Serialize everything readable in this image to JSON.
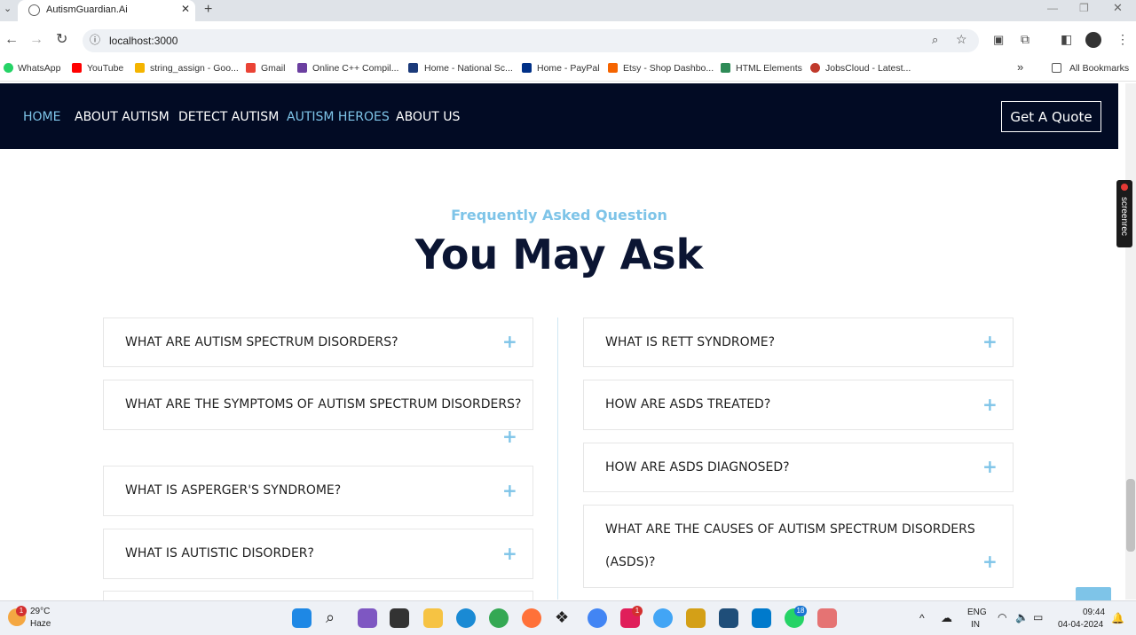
{
  "browser": {
    "tab_title": "AutismGuardian.Ai",
    "url": "localhost:3000",
    "bookmarks": [
      "WhatsApp",
      "YouTube",
      "string_assign - Goo...",
      "Gmail",
      "Online C++ Compil...",
      "Home - National Sc...",
      "Home - PayPal",
      "Etsy - Shop Dashbo...",
      "HTML Elements",
      "JobsCloud - Latest..."
    ],
    "all_bookmarks": "All Bookmarks",
    "overflow": "»"
  },
  "nav": {
    "links": [
      "HOME",
      "ABOUT AUTISM",
      "DETECT AUTISM",
      "AUTISM HEROES",
      "ABOUT US"
    ],
    "quote": "Get A Quote"
  },
  "screenrec": "screenrec",
  "faq": {
    "subtitle": "Frequently Asked Question",
    "title": "You May Ask",
    "left": [
      "WHAT ARE AUTISM SPECTRUM DISORDERS?",
      "WHAT ARE THE SYMPTOMS OF AUTISM SPECTRUM DISORDERS?",
      "WHAT IS ASPERGER'S SYNDROME?",
      "WHAT IS AUTISTIC DISORDER?"
    ],
    "right": [
      "WHAT IS RETT SYNDROME?",
      "HOW ARE ASDS TREATED?",
      "HOW ARE ASDS DIAGNOSED?",
      "WHAT ARE THE CAUSES OF AUTISM SPECTRUM DISORDERS",
      "(ASDS)?"
    ],
    "plus": "+"
  },
  "taskbar": {
    "weather_temp": "29°C",
    "weather_desc": "Haze",
    "weather_badge": "1",
    "lang1": "ENG",
    "lang2": "IN",
    "time": "09:44",
    "date": "04-04-2024",
    "badge_slack": "1",
    "badge_whatsapp": "18"
  },
  "colors": {
    "nav_bg": "#020b24",
    "accent": "#7ec4e8",
    "title": "#0b1533"
  }
}
